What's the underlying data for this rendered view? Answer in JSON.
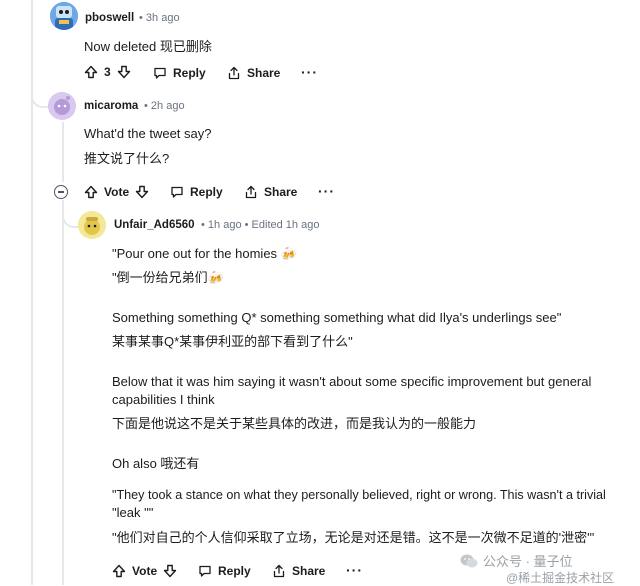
{
  "comments": [
    {
      "username": "pboswell",
      "time": "3h ago",
      "lines": [
        "Now deleted  现已删除"
      ],
      "vote_count": "3",
      "reply_label": "Reply",
      "share_label": "Share",
      "more_label": "···"
    },
    {
      "username": "micaroma",
      "time": "2h ago",
      "lines": [
        "What'd the tweet say?",
        "推文说了什么?"
      ],
      "vote_label": "Vote",
      "reply_label": "Reply",
      "share_label": "Share",
      "more_label": "···"
    },
    {
      "username": "Unfair_Ad6560",
      "time": "1h ago",
      "edited": "Edited 1h ago",
      "lines": [
        "\"Pour one out for the homies 🍻",
        "\"倒一份给兄弟们🍻",
        "Something something Q* something something what did Ilya's underlings see\"",
        "某事某事Q*某事伊利亚的部下看到了什么\"",
        "Below that it was him saying it wasn't about some specific improvement but general",
        "capabilities I think",
        "下面是他说这不是关于某些具体的改进，而是我认为的一般能力",
        "Oh also   哦还有",
        "\"They took a stance on what they personally believed, right or wrong. This wasn't a trivial",
        "\"leak \"\"",
        "\"他们对自己的个人信仰采取了立场，无论是对还是错。这不是一次微不足道的'泄密'\""
      ],
      "vote_label": "Vote",
      "reply_label": "Reply",
      "share_label": "Share",
      "more_label": "···"
    }
  ],
  "watermark": "公众号 · 量子位",
  "watermark2": "@稀土掘金技术社区",
  "colors": {
    "line": "#e5e7ea",
    "meta": "#6b7280",
    "text": "#1c1c1c"
  }
}
